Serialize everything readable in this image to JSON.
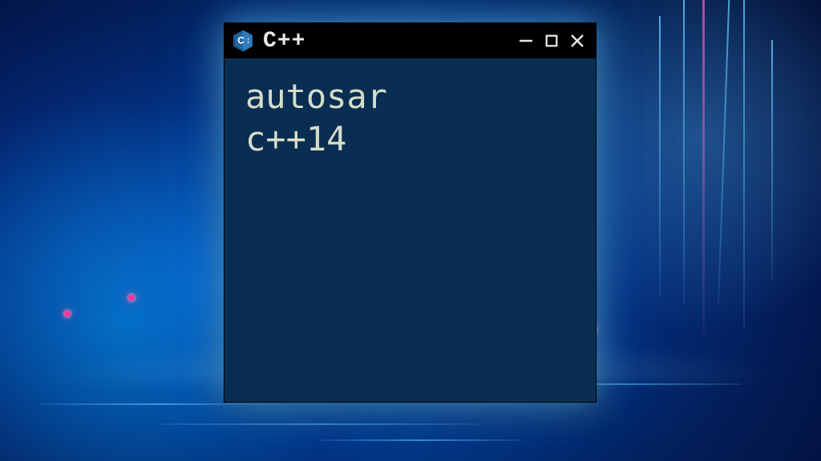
{
  "window": {
    "title": "C++",
    "icon_name": "cpp-logo-icon"
  },
  "content": {
    "line1": "autosar",
    "line2": "c++14"
  },
  "colors": {
    "titlebar_bg": "#000000",
    "content_bg": "#0a2d52",
    "text": "#d4ddc8",
    "title_text": "#e8e8e8",
    "glow": "#64c8ff"
  }
}
